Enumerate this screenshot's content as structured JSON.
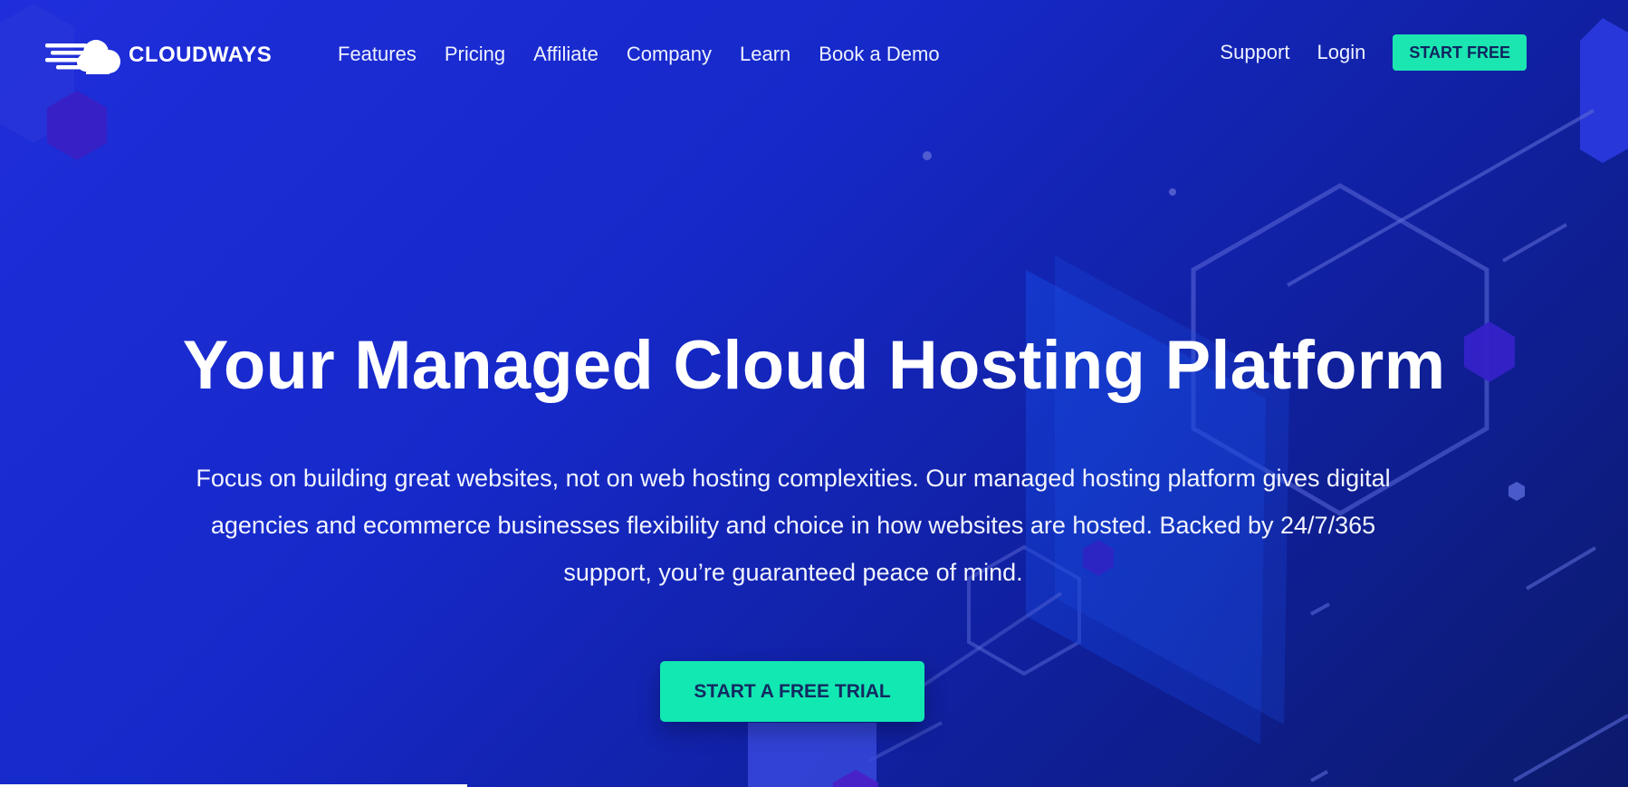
{
  "brand": {
    "name": "CLOUDWAYS",
    "logo_icon": "cloud-logo-icon"
  },
  "nav": {
    "links": [
      {
        "label": "Features"
      },
      {
        "label": "Pricing"
      },
      {
        "label": "Affiliate"
      },
      {
        "label": "Company"
      },
      {
        "label": "Learn"
      },
      {
        "label": "Book a Demo"
      }
    ],
    "support": "Support",
    "login": "Login",
    "start_free": "START FREE"
  },
  "hero": {
    "title": "Your Managed Cloud Hosting Platform",
    "subtitle": "Focus on building great websites, not on web hosting complexities. Our managed hosting platform gives digital agencies and ecommerce businesses flexibility and choice in how websites are hosted. Backed by 24/7/365 support, you’re guaranteed peace of mind.",
    "cta": "START A FREE TRIAL"
  },
  "colors": {
    "accent": "#12e8b2",
    "background_start": "#1f2edb",
    "background_end": "#0b1a6b",
    "button_text": "#122a61"
  }
}
